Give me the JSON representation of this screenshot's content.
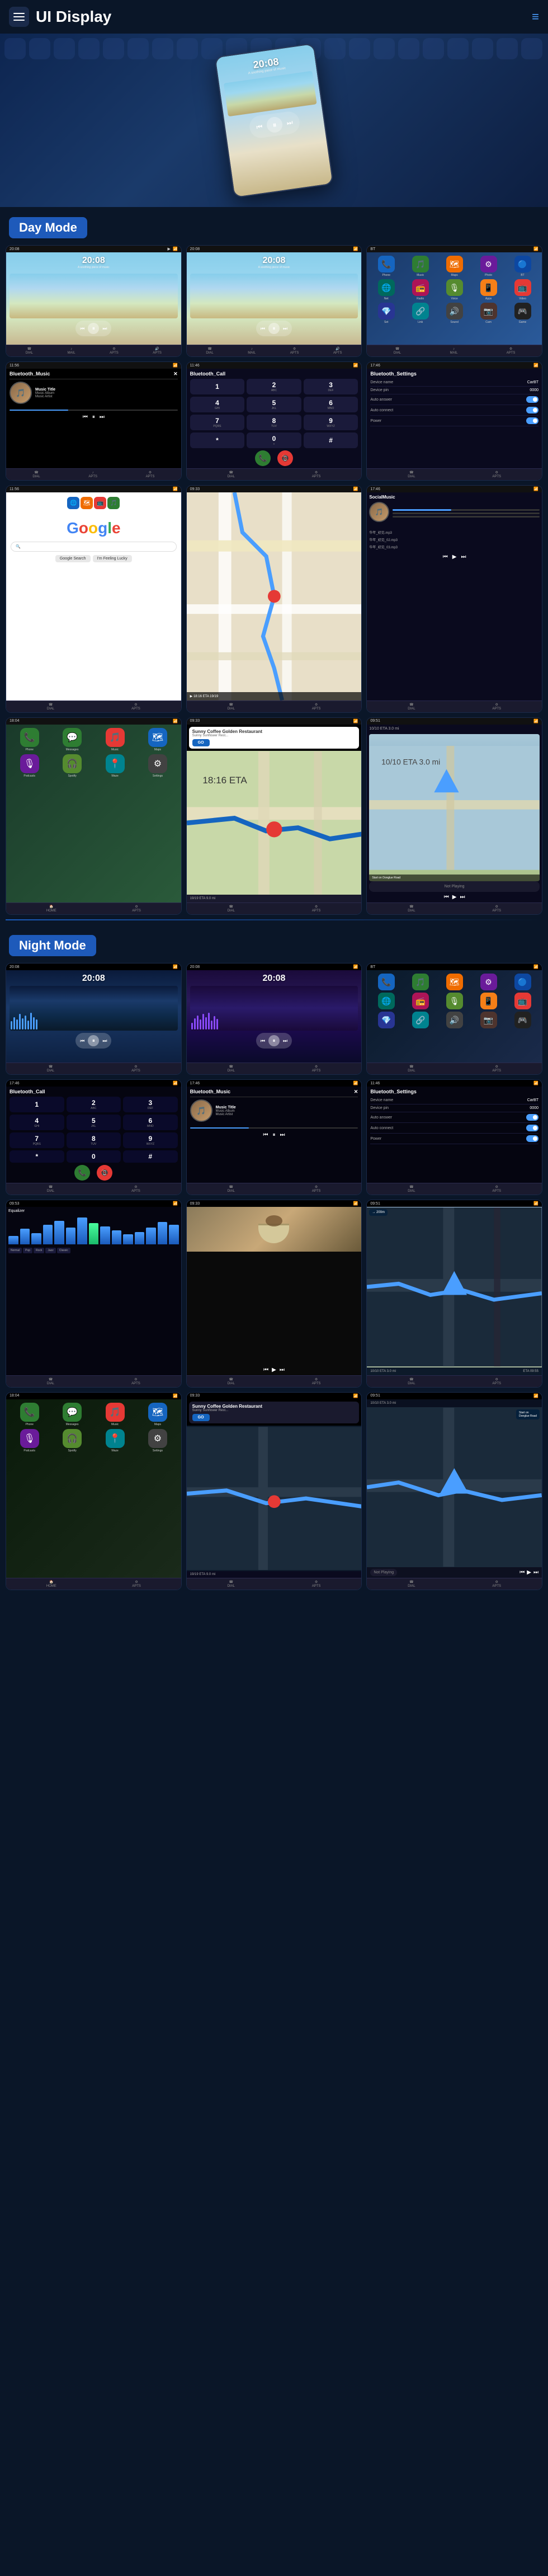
{
  "app": {
    "title": "UI Display",
    "menu_icon": "≡",
    "nav_icon": "≡"
  },
  "hero": {
    "time": "20:08",
    "subtitle": "A soothing piece of music"
  },
  "sections": {
    "day_mode": "Day Mode",
    "night_mode": "Night Mode"
  },
  "day": {
    "row1": [
      {
        "type": "music",
        "time": "20:08",
        "subtitle": "A soothing piece of music"
      },
      {
        "type": "music",
        "time": "20:08",
        "subtitle": "A soothing piece of music"
      },
      {
        "type": "apps",
        "mode": "day"
      }
    ],
    "row2": [
      {
        "type": "bt_music",
        "title": "Bluetooth_Music",
        "track_title": "Music Title",
        "album": "Music Album",
        "artist": "Music Artist"
      },
      {
        "type": "bt_call",
        "title": "Bluetooth_Call"
      },
      {
        "type": "bt_settings",
        "title": "Bluetooth_Settings",
        "device_name": "CarBT",
        "device_pin": "0000",
        "auto_answer": "Auto answer",
        "auto_connect": "Auto connect",
        "power": "Power"
      }
    ],
    "row3": [
      {
        "type": "google"
      },
      {
        "type": "map"
      },
      {
        "type": "social",
        "title": "SocialMusic"
      }
    ],
    "row4": [
      {
        "type": "carplay"
      },
      {
        "type": "waze_nav"
      },
      {
        "type": "not_playing"
      }
    ]
  },
  "night": {
    "row1": [
      {
        "type": "music_night",
        "time": "20:08",
        "subtitle": ""
      },
      {
        "type": "music_night2",
        "time": "20:08",
        "subtitle": ""
      },
      {
        "type": "apps_night"
      }
    ],
    "row2": [
      {
        "type": "bt_call_night",
        "title": "Bluetooth_Call"
      },
      {
        "type": "bt_music_night",
        "title": "Bluetooth_Music",
        "track_title": "Music Title",
        "album": "Music Album",
        "artist": "Music Artist"
      },
      {
        "type": "bt_settings_night",
        "title": "Bluetooth_Settings",
        "device_name": "CarBT",
        "device_pin": "0000"
      }
    ],
    "row3": [
      {
        "type": "eq_night"
      },
      {
        "type": "food_media"
      },
      {
        "type": "road_nav"
      }
    ],
    "row4": [
      {
        "type": "carplay_night"
      },
      {
        "type": "waze_nav_night"
      },
      {
        "type": "road_map_night"
      }
    ]
  },
  "bottom_nav": {
    "items": [
      "DIAL",
      "☎",
      "♪",
      "APTS",
      "APTS"
    ]
  },
  "dialpad": {
    "keys": [
      {
        "num": "1",
        "letters": ""
      },
      {
        "num": "2",
        "letters": "ABC"
      },
      {
        "num": "3",
        "letters": "DEF"
      },
      {
        "num": "4",
        "letters": "GHI"
      },
      {
        "num": "5",
        "letters": "JKL"
      },
      {
        "num": "6",
        "letters": "MNO"
      },
      {
        "num": "7",
        "letters": "PQRS"
      },
      {
        "num": "8",
        "letters": "TUV"
      },
      {
        "num": "9",
        "letters": "WXYZ"
      },
      {
        "num": "*",
        "letters": ""
      },
      {
        "num": "0",
        "letters": "+"
      },
      {
        "num": "#",
        "letters": ""
      }
    ]
  },
  "settings": {
    "device_name_label": "Device name",
    "device_name_val": "CarBT",
    "device_pin_label": "Device pin",
    "device_pin_val": "0000",
    "auto_answer_label": "Auto answer",
    "auto_connect_label": "Auto connect",
    "power_label": "Power"
  },
  "nav_card": {
    "title": "Sunny Coffee Golden Restaurant",
    "subtitle": "Sunny Sunflower Rest...",
    "eta": "18:16 ETA",
    "distance": "19/19 ETA  9.0 mi",
    "go": "GO"
  },
  "not_playing": {
    "label": "Not Playing",
    "road": "Start on Donglue Road",
    "distance": "10/10 ETA  3.0 mi"
  },
  "social_music": {
    "title": "SocialMusic",
    "tracks": [
      "华年_初见.mp3",
      "华年_初见_02.mp3",
      "华年_初见_03.mp3"
    ]
  },
  "app_icons": {
    "colors": [
      "#e53935",
      "#1565c0",
      "#2e7d32",
      "#ef6c00",
      "#6a1b9a",
      "#00695c",
      "#ad1457",
      "#283593",
      "#00838f",
      "#558b2f",
      "#f57f17",
      "#4e342e",
      "#0d47a1",
      "#424242",
      "#212121"
    ],
    "emojis": [
      "📞",
      "🎵",
      "🗺",
      "⚙",
      "🔵",
      "📷",
      "🎮",
      "🌐",
      "📻",
      "🎙",
      "📱",
      "🔊",
      "🔗",
      "📺",
      "💎"
    ]
  }
}
